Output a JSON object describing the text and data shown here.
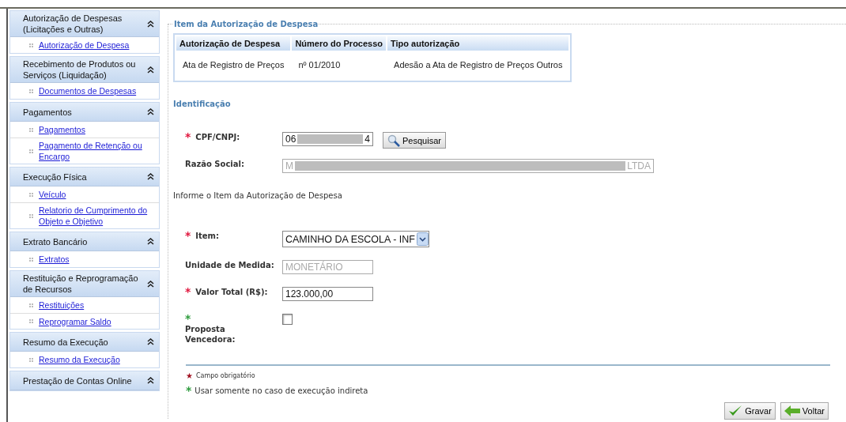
{
  "sidebar": {
    "groups": [
      {
        "title": "Autorização de Despesas (Licitações e Outras)",
        "expanded": true,
        "items": [
          "Autorização de Despesa"
        ]
      },
      {
        "title": "Recebimento de Produtos ou Serviços (Liquidação)",
        "expanded": true,
        "items": [
          "Documentos de Despesas"
        ]
      },
      {
        "title": "Pagamentos",
        "expanded": true,
        "items": [
          "Pagamentos",
          "Pagamento de Retenção ou Encargo"
        ]
      },
      {
        "title": "Execução Física",
        "expanded": true,
        "items": [
          "Veículo",
          "Relatorio de Cumprimento do Objeto e Objetivo"
        ]
      },
      {
        "title": "Extrato Bancário",
        "expanded": true,
        "items": [
          "Extratos"
        ]
      },
      {
        "title": "Restituição e Reprogramação de Recursos",
        "expanded": true,
        "items": [
          "Restituições",
          "Reprogramar Saldo"
        ]
      },
      {
        "title": "Resumo da Execução",
        "expanded": true,
        "items": [
          "Resumo da Execução"
        ]
      },
      {
        "title": "Prestação de Contas Online",
        "expanded": true
      }
    ]
  },
  "main": {
    "legend": "Item da Autorização de Despesa",
    "table": {
      "columns": [
        "Autorização de Despesa",
        "Número do Processo",
        "Tipo autorização"
      ],
      "rows": [
        [
          "Ata de Registro de Preços",
          "nº 01/2010",
          "Adesão a Ata de Registro de Preços Outros"
        ]
      ]
    },
    "section_title": "Identificação",
    "fields": [
      {
        "kind": "text",
        "mark": "*",
        "color": "#e0123a",
        "label": "CPF/CNPJ:",
        "value_start": "06",
        "value_end": "4",
        "redacted": true,
        "disabled": false,
        "button": "Pesquisar"
      },
      {
        "kind": "wide_text",
        "label": "Razão Social:",
        "value_start": "M",
        "value_end": "LTDA",
        "redacted": true,
        "disabled": true
      },
      {
        "kind": "note",
        "label": "Informe o Item da Autorização de Despesa"
      },
      {
        "kind": "select",
        "mark": "*",
        "color": "#e0123a",
        "label": "Item:",
        "value": "CAMINHO DA ESCOLA - INF"
      },
      {
        "kind": "text",
        "label": "Unidade de Medida:",
        "value_start": "MONETÁRIO",
        "disabled": true
      },
      {
        "kind": "text",
        "mark": "*",
        "color": "#e0123a",
        "label": "Valor Total (R$):",
        "value_start": "123.000,00",
        "disabled": false
      },
      {
        "kind": "checkbox",
        "mark": "*",
        "color": "#2a9a3a",
        "label": "Proposta Vencedora:",
        "checked": false
      }
    ],
    "legend_notes": [
      {
        "kind": "small",
        "mark": "★",
        "color": "#a01020",
        "text": "Campo obrigatório"
      },
      {
        "kind": "normal",
        "mark": "*",
        "color": "#2a9a3a",
        "text": "Usar somente no caso de execução indireta"
      }
    ],
    "buttons": [
      {
        "kind": "save",
        "label": "Gravar"
      },
      {
        "kind": "back",
        "label": "Voltar"
      }
    ]
  }
}
